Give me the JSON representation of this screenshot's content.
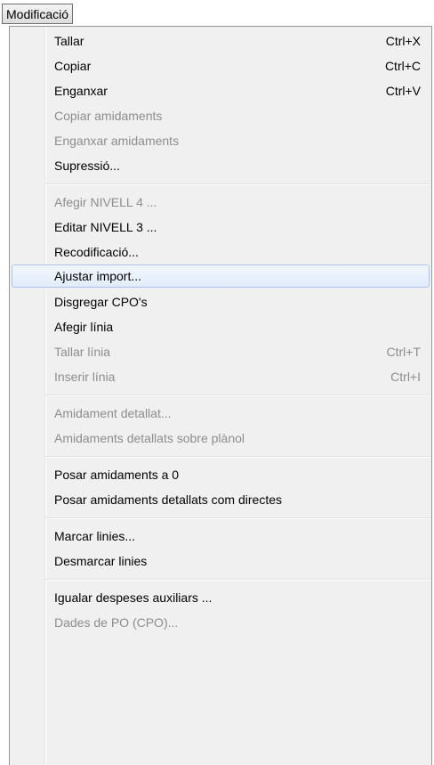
{
  "menubar": {
    "title": "Modificació"
  },
  "menu": {
    "tallar": {
      "label": "Tallar",
      "shortcut": "Ctrl+X"
    },
    "copiar": {
      "label": "Copiar",
      "shortcut": "Ctrl+C"
    },
    "enganxar": {
      "label": "Enganxar",
      "shortcut": "Ctrl+V"
    },
    "copiar_amidaments": {
      "label": "Copiar amidaments"
    },
    "enganxar_amidaments": {
      "label": "Enganxar amidaments"
    },
    "supressio": {
      "label": "Supressió..."
    },
    "afegir_nivell4": {
      "label": "Afegir NIVELL 4 ..."
    },
    "editar_nivell3": {
      "label": "Editar NIVELL 3 ..."
    },
    "recodificacio": {
      "label": "Recodificació..."
    },
    "ajustar_import": {
      "label": "Ajustar import..."
    },
    "disgregar_cpo": {
      "label": "Disgregar CPO's"
    },
    "afegir_linia": {
      "label": "Afegir línia"
    },
    "tallar_linia": {
      "label": "Tallar línia",
      "shortcut": "Ctrl+T"
    },
    "inserir_linia": {
      "label": "Inserir línia",
      "shortcut": "Ctrl+I"
    },
    "amidament_detallat": {
      "label": "Amidament detallat..."
    },
    "amidaments_planol": {
      "label": "Amidaments detallats sobre plànol"
    },
    "posar_zero": {
      "label": "Posar amidaments a 0"
    },
    "posar_directes": {
      "label": "Posar amidaments detallats com directes"
    },
    "marcar_linies": {
      "label": "Marcar linies..."
    },
    "desmarcar_linies": {
      "label": "Desmarcar linies"
    },
    "igualar_despeses": {
      "label": "Igualar despeses auxiliars ..."
    },
    "dades_po": {
      "label": "Dades de PO (CPO)..."
    }
  }
}
